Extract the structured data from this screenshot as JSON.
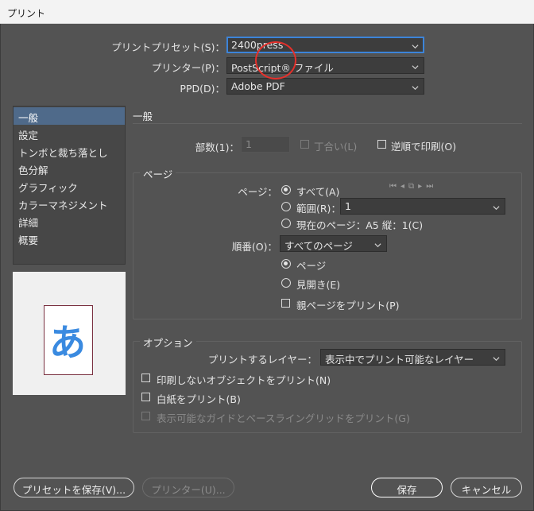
{
  "window": {
    "title": "プリント"
  },
  "top": {
    "preset_label": "プリントプリセット(S)：",
    "preset_value": "2400press",
    "printer_label": "プリンター(P)：",
    "printer_value": "PostScript® ファイル",
    "ppd_label": "PPD(D)：",
    "ppd_value": "Adobe PDF"
  },
  "sidebar": {
    "items": [
      {
        "label": "一般"
      },
      {
        "label": "設定"
      },
      {
        "label": "トンボと裁ち落とし"
      },
      {
        "label": "色分解"
      },
      {
        "label": "グラフィック"
      },
      {
        "label": "カラーマネジメント"
      },
      {
        "label": "詳細"
      },
      {
        "label": "概要"
      }
    ]
  },
  "preview": {
    "glyph": "あ"
  },
  "general": {
    "heading": "一般",
    "copies_label": "部数(1)：",
    "copies_value": "1",
    "collate_label": "丁合い(L)",
    "reverse_label": "逆順で印刷(O)"
  },
  "pages": {
    "group_title": "ページ",
    "pages_label": "ページ：",
    "all_label": "すべて(A)",
    "range_label": "範囲(R)：",
    "range_value": "1",
    "current_label": "現在のページ：A5 縦：1(C)",
    "order_label": "順番(O)：",
    "order_value": "すべてのページ",
    "page_radio_label": "ページ",
    "spread_radio_label": "見開き(E)",
    "master_label": "親ページをプリント(P)",
    "nav_icons": [
      "first-page-icon",
      "prev-page-icon",
      "spread-icon",
      "next-page-icon",
      "last-page-icon"
    ]
  },
  "options": {
    "group_title": "オプション",
    "layers_label": "プリントするレイヤー：",
    "layers_value": "表示中でプリント可能なレイヤー",
    "nonprint_label": "印刷しないオブジェクトをプリント(N)",
    "blank_label": "白紙をプリント(B)",
    "guides_label": "表示可能なガイドとベースライングリッドをプリント(G)"
  },
  "footer": {
    "save_preset": "プリセットを保存(V)...",
    "printer_btn": "プリンター(U)...",
    "save": "保存",
    "cancel": "キャンセル"
  },
  "colors": {
    "accent": "#3c84d9",
    "annotation": "#e5302b",
    "selected": "#4f6a8a"
  }
}
